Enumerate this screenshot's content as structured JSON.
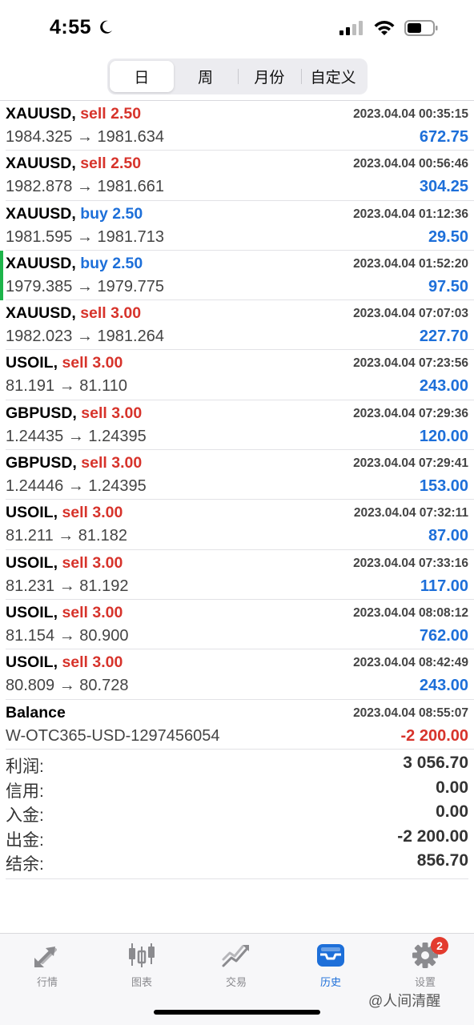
{
  "status_bar": {
    "time": "4:55"
  },
  "period_tabs": {
    "items": [
      "日",
      "周",
      "月份",
      "自定义"
    ],
    "active": "日"
  },
  "trades": [
    {
      "symbol": "XAUUSD,",
      "side": "sell 2.50",
      "side_type": "sell",
      "time": "2023.04.04 00:35:15",
      "prices": "1984.325 → 1981.634",
      "profit": "672.75"
    },
    {
      "symbol": "XAUUSD,",
      "side": "sell 2.50",
      "side_type": "sell",
      "time": "2023.04.04 00:56:46",
      "prices": "1982.878 → 1981.661",
      "profit": "304.25"
    },
    {
      "symbol": "XAUUSD,",
      "side": "buy 2.50",
      "side_type": "buy",
      "time": "2023.04.04 01:12:36",
      "prices": "1981.595 → 1981.713",
      "profit": "29.50"
    },
    {
      "symbol": "XAUUSD,",
      "side": "buy 2.50",
      "side_type": "buy",
      "time": "2023.04.04 01:52:20",
      "prices": "1979.385 → 1979.775",
      "profit": "97.50"
    },
    {
      "symbol": "XAUUSD,",
      "side": "sell 3.00",
      "side_type": "sell",
      "time": "2023.04.04 07:07:03",
      "prices": "1982.023 → 1981.264",
      "profit": "227.70"
    },
    {
      "symbol": "USOIL,",
      "side": "sell 3.00",
      "side_type": "sell",
      "time": "2023.04.04 07:23:56",
      "prices": "81.191 → 81.110",
      "profit": "243.00"
    },
    {
      "symbol": "GBPUSD,",
      "side": "sell 3.00",
      "side_type": "sell",
      "time": "2023.04.04 07:29:36",
      "prices": "1.24435 → 1.24395",
      "profit": "120.00"
    },
    {
      "symbol": "GBPUSD,",
      "side": "sell 3.00",
      "side_type": "sell",
      "time": "2023.04.04 07:29:41",
      "prices": "1.24446 → 1.24395",
      "profit": "153.00"
    },
    {
      "symbol": "USOIL,",
      "side": "sell 3.00",
      "side_type": "sell",
      "time": "2023.04.04 07:32:11",
      "prices": "81.211 → 81.182",
      "profit": "87.00"
    },
    {
      "symbol": "USOIL,",
      "side": "sell 3.00",
      "side_type": "sell",
      "time": "2023.04.04 07:33:16",
      "prices": "81.231 → 81.192",
      "profit": "117.00"
    },
    {
      "symbol": "USOIL,",
      "side": "sell 3.00",
      "side_type": "sell",
      "time": "2023.04.04 08:08:12",
      "prices": "81.154 → 80.900",
      "profit": "762.00"
    },
    {
      "symbol": "USOIL,",
      "side": "sell 3.00",
      "side_type": "sell",
      "time": "2023.04.04 08:42:49",
      "prices": "80.809 → 80.728",
      "profit": "243.00"
    }
  ],
  "balance": {
    "label": "Balance",
    "time": "2023.04.04 08:55:07",
    "account": "W-OTC365-USD-1297456054",
    "amount": "-2 200.00"
  },
  "summary": [
    {
      "label": "利润:",
      "value": "3 056.70"
    },
    {
      "label": "信用:",
      "value": "0.00"
    },
    {
      "label": "入金:",
      "value": "0.00"
    },
    {
      "label": "出金:",
      "value": "-2 200.00"
    },
    {
      "label": "结余:",
      "value": "856.70"
    }
  ],
  "tabbar": {
    "items": [
      {
        "label": "行情",
        "icon": "quotes-arrows-icon"
      },
      {
        "label": "图表",
        "icon": "candlestick-chart-icon"
      },
      {
        "label": "交易",
        "icon": "trade-trend-icon"
      },
      {
        "label": "历史",
        "icon": "history-inbox-icon"
      },
      {
        "label": "设置",
        "icon": "gear-icon",
        "badge": "2"
      }
    ],
    "active": "历史"
  },
  "watermark": "@人间清醒",
  "colors": {
    "sell": "#d7332b",
    "buy": "#1d6fd9",
    "profit": "#1d6fd9",
    "active_indicator": "#1db44a",
    "tab_active": "#1d6fd9"
  }
}
